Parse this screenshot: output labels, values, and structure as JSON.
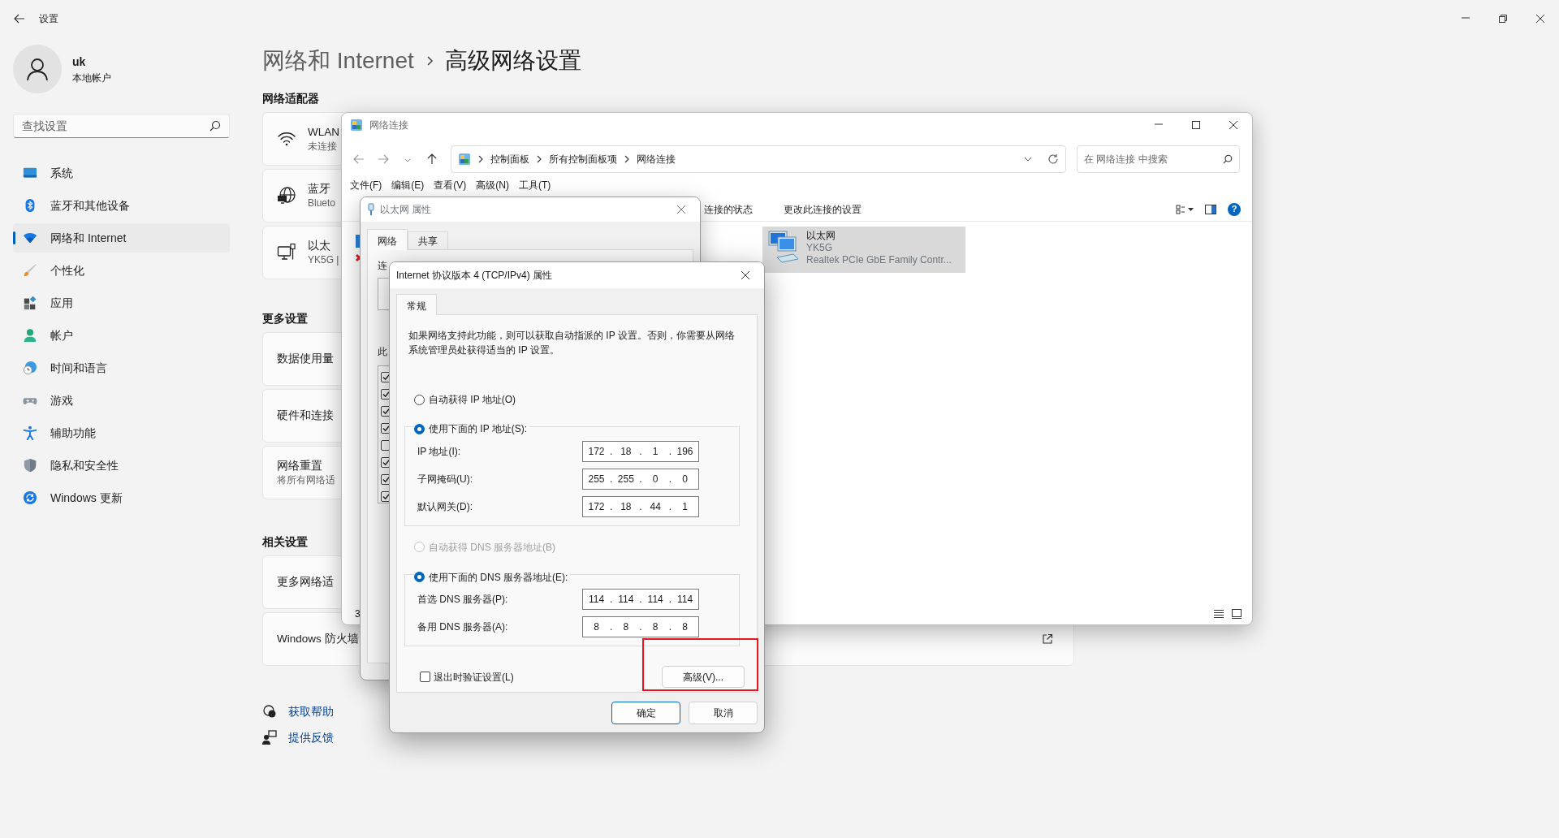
{
  "settings": {
    "title": "设置",
    "user": {
      "name": "uk",
      "account": "本地帐户"
    },
    "search": {
      "placeholder": "查找设置"
    },
    "nav": [
      {
        "label": "系统",
        "selected": false
      },
      {
        "label": "蓝牙和其他设备",
        "selected": false
      },
      {
        "label": "网络和 Internet",
        "selected": true
      },
      {
        "label": "个性化",
        "selected": false
      },
      {
        "label": "应用",
        "selected": false
      },
      {
        "label": "帐户",
        "selected": false
      },
      {
        "label": "时间和语言",
        "selected": false
      },
      {
        "label": "游戏",
        "selected": false
      },
      {
        "label": "辅助功能",
        "selected": false
      },
      {
        "label": "隐私和安全性",
        "selected": false
      },
      {
        "label": "Windows 更新",
        "selected": false
      }
    ],
    "breadcrumb": [
      {
        "label": "网络和 Internet",
        "current": false
      },
      {
        "label": "高级网络设置",
        "current": true
      }
    ],
    "sections": [
      {
        "title": "网络适配器",
        "cards": [
          {
            "title": "WLAN",
            "subtitle": "未连接"
          },
          {
            "title": "蓝牙",
            "subtitle": "Blueto"
          },
          {
            "title": "以太",
            "subtitle": "YK5G |"
          }
        ]
      },
      {
        "title": "更多设置",
        "cards": [
          {
            "title": "数据使用量"
          },
          {
            "title": "硬件和连接"
          },
          {
            "title": "网络重置",
            "subtitle": "将所有网络适"
          }
        ]
      },
      {
        "title": "相关设置",
        "cards": [
          {
            "title": "更多网络适"
          },
          {
            "title": "Windows 防火墙",
            "external": true
          }
        ]
      }
    ],
    "help_links": [
      "获取帮助",
      "提供反馈"
    ]
  },
  "network_window": {
    "title": "网络连接",
    "path": [
      "控制面板",
      "所有控制面板项",
      "网络连接"
    ],
    "search": {
      "placeholder": "在 网络连接 中搜索"
    },
    "menu": [
      "文件(F)",
      "编辑(E)",
      "查看(V)",
      "高级(N)",
      "工具(T)"
    ],
    "commands": [
      "连接的状态",
      "更改此连接的设置"
    ],
    "help": "?",
    "items": [
      {
        "name": "以太网",
        "network": "YK5G",
        "device": "Realtek PCIe GbE Family Contr...",
        "selected": true
      }
    ],
    "status": "3"
  },
  "ethernet_dialog": {
    "title": "以太网 属性",
    "tabs": [
      {
        "label": "网络",
        "selected": true
      },
      {
        "label": "共享",
        "selected": false
      }
    ],
    "labels": [
      "连",
      "此"
    ],
    "components": [
      {
        "checked": true
      },
      {
        "checked": true
      },
      {
        "checked": true
      },
      {
        "checked": true
      },
      {
        "checked": false
      },
      {
        "checked": true
      },
      {
        "checked": true
      },
      {
        "checked": true
      }
    ]
  },
  "ipv4_dialog": {
    "title": "Internet 协议版本 4 (TCP/IPv4) 属性",
    "tabs": [
      {
        "label": "常规",
        "selected": true
      }
    ],
    "description": "如果网络支持此功能，则可以获取自动指派的 IP 设置。否则，你需要从网络系统管理员处获得适当的 IP 设置。",
    "separator": ".",
    "ip_options": [
      {
        "label": "自动获得 IP 地址(O)",
        "selected": false,
        "disabled": false
      },
      {
        "label": "使用下面的 IP 地址(S):",
        "selected": true,
        "disabled": false
      }
    ],
    "ip_fields": [
      {
        "label": "IP 地址(I):",
        "octets": [
          "172",
          "18",
          "1",
          "196"
        ]
      },
      {
        "label": "子网掩码(U):",
        "octets": [
          "255",
          "255",
          "0",
          "0"
        ]
      },
      {
        "label": "默认网关(D):",
        "octets": [
          "172",
          "18",
          "44",
          "1"
        ]
      }
    ],
    "dns_options": [
      {
        "label": "自动获得 DNS 服务器地址(B)",
        "selected": false,
        "disabled": true
      },
      {
        "label": "使用下面的 DNS 服务器地址(E):",
        "selected": true,
        "disabled": false
      }
    ],
    "dns_fields": [
      {
        "label": "首选 DNS 服务器(P):",
        "octets": [
          "114",
          "114",
          "114",
          "114"
        ]
      },
      {
        "label": "备用 DNS 服务器(A):",
        "octets": [
          "8",
          "8",
          "8",
          "8"
        ]
      }
    ],
    "validate": {
      "label": "退出时验证设置(L)",
      "checked": false
    },
    "advanced_button": "高级(V)...",
    "highlighted": true,
    "buttons": [
      {
        "label": "确定",
        "default": true
      },
      {
        "label": "取消",
        "default": false
      }
    ]
  }
}
